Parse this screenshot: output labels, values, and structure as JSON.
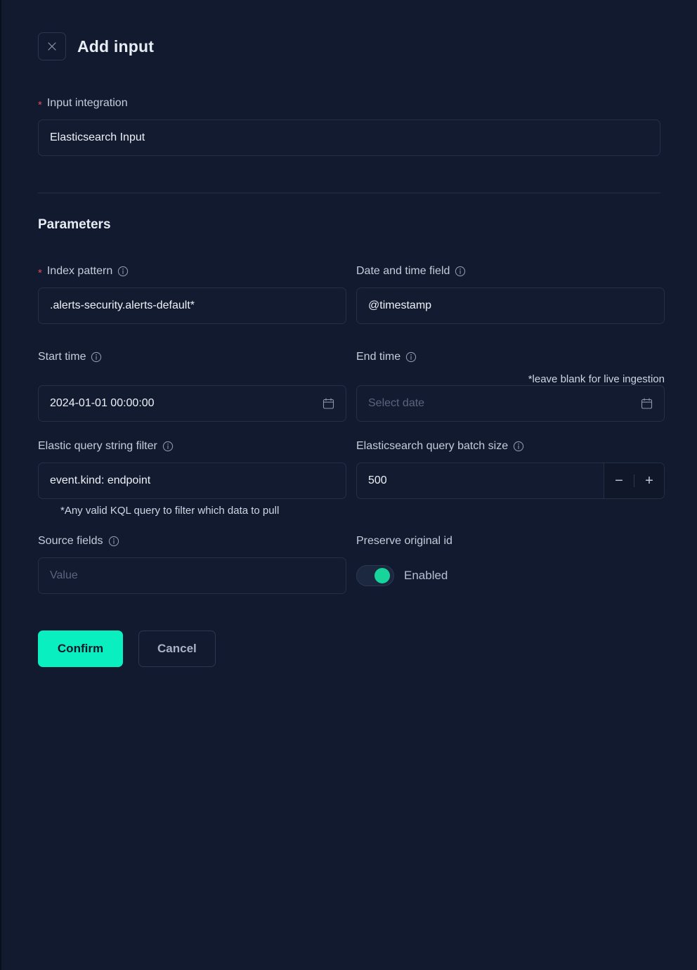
{
  "header": {
    "title": "Add input",
    "close_icon": "close-icon"
  },
  "input_integration": {
    "label": "Input integration",
    "required_marker": "*",
    "value": "Elasticsearch Input",
    "chevron_icon": "chevron-down-icon"
  },
  "parameters": {
    "title": "Parameters",
    "index_pattern": {
      "label": "Index pattern",
      "required_marker": "*",
      "info_icon": "info-circle-icon",
      "value": ".alerts-security.alerts-default*"
    },
    "date_time_field": {
      "label": "Date and time field",
      "info_icon": "info-circle-icon",
      "value": "@timestamp"
    },
    "start_time": {
      "label": "Start time",
      "info_icon": "info-circle-icon",
      "value": "2024-01-01 00:00:00",
      "calendar_icon": "calendar-icon"
    },
    "end_time": {
      "label": "End time",
      "info_icon": "info-circle-icon",
      "value": "",
      "placeholder": "Select date",
      "hint": "*leave blank for live ingestion",
      "calendar_icon": "calendar-icon"
    },
    "query_string_filter": {
      "label": "Elastic query string filter",
      "info_icon": "info-circle-icon",
      "value": "event.kind: endpoint",
      "hint": "*Any valid KQL query to filter which data to pull"
    },
    "batch_size": {
      "label": "Elasticsearch query batch size",
      "info_icon": "info-circle-icon",
      "value": "500",
      "decrement_label": "−",
      "increment_label": "+"
    },
    "source_fields": {
      "label": "Source fields",
      "info_icon": "info-circle-icon",
      "value": "",
      "placeholder": "Value"
    },
    "preserve_original_id": {
      "label": "Preserve original id",
      "toggle_state_label": "Enabled",
      "enabled": true
    }
  },
  "actions": {
    "confirm_label": "Confirm",
    "cancel_label": "Cancel"
  },
  "colors": {
    "accent": "#09efc0",
    "toggle_on": "#16d49a",
    "required": "#e04a5f",
    "panel_bg": "#111a2e",
    "field_bg": "#121b30"
  }
}
